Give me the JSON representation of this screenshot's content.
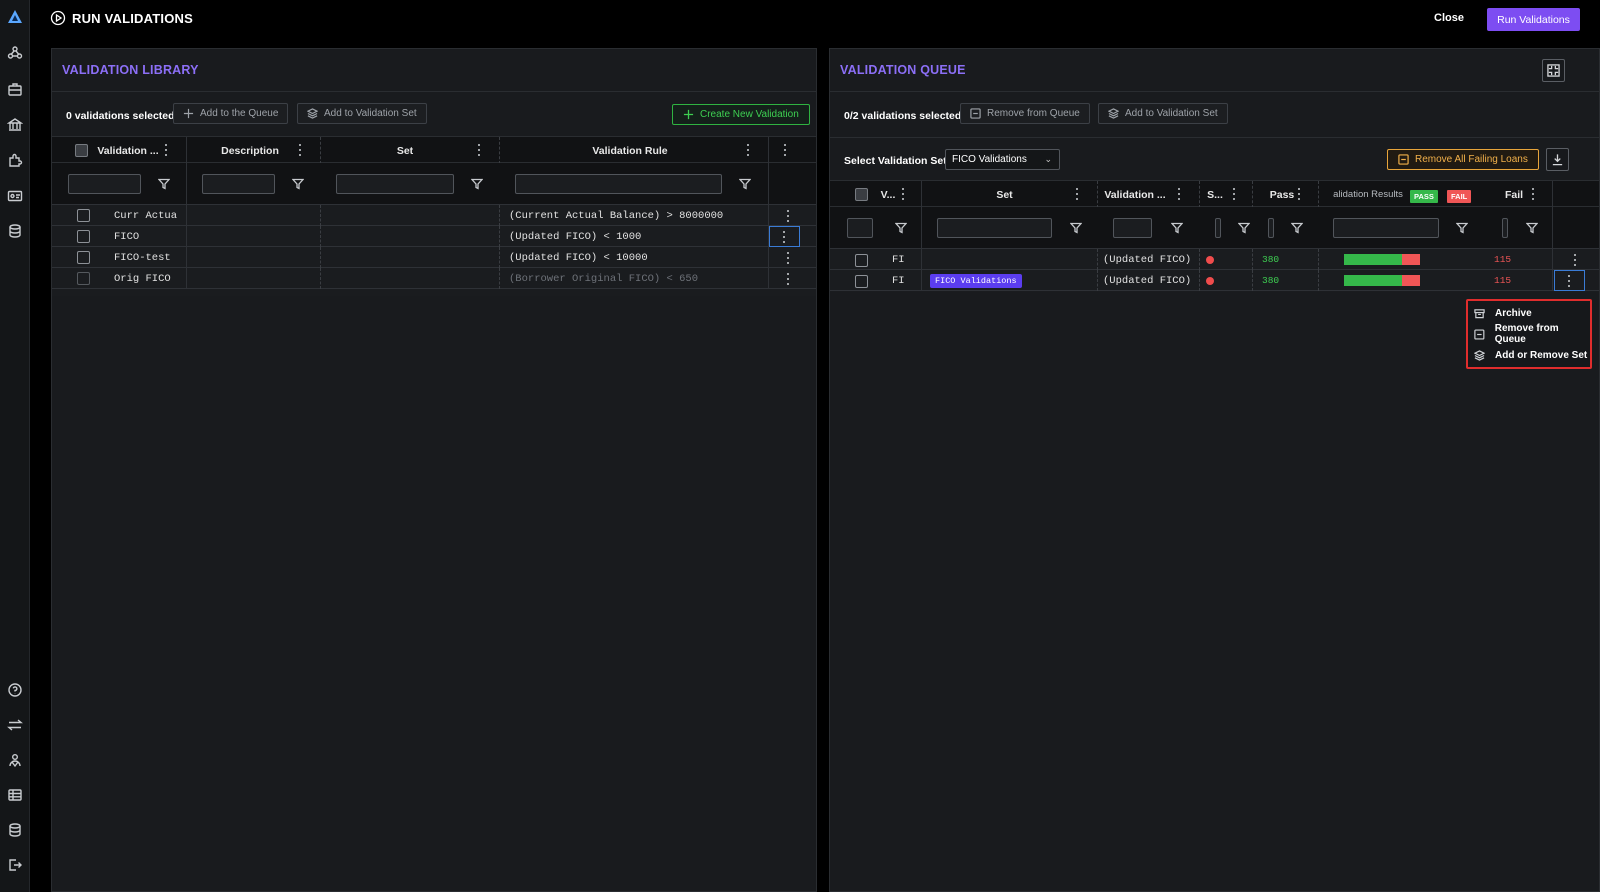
{
  "header": {
    "title": "RUN VALIDATIONS",
    "close_label": "Close",
    "run_label": "Run Validations"
  },
  "rail_icons": [
    "logo-icon",
    "network-icon",
    "briefcase-icon",
    "bank-icon",
    "puzzle-icon",
    "id-card-icon",
    "database-icon",
    "help-icon",
    "transfer-icon",
    "users-icon",
    "table-icon",
    "database-icon",
    "logout-icon"
  ],
  "library": {
    "title": "VALIDATION LIBRARY",
    "selected_text": "0 validations selected",
    "add_queue_label": "Add to the Queue",
    "add_set_label": "Add to Validation Set",
    "create_label": "Create New Validation",
    "columns": [
      "Validation ...",
      "Description",
      "Set",
      "Validation Rule"
    ],
    "rows": [
      {
        "name": "Curr Actua",
        "description": "",
        "set": "",
        "rule": "(Current Actual Balance) > 8000000",
        "disabled": false
      },
      {
        "name": "FICO",
        "description": "",
        "set": "",
        "rule": "(Updated FICO) < 1000",
        "disabled": false
      },
      {
        "name": "FICO-test",
        "description": "",
        "set": "",
        "rule": "(Updated FICO) < 10000",
        "disabled": false
      },
      {
        "name": "Orig FICO",
        "description": "",
        "set": "",
        "rule": "(Borrower Original FICO) < 650",
        "disabled": true
      }
    ]
  },
  "queue": {
    "title": "VALIDATION QUEUE",
    "selected_text": "0/2 validations selected",
    "remove_label": "Remove from Queue",
    "add_set_label": "Add to Validation Set",
    "select_set_label": "Select Validation Set",
    "select_set_value": "FICO Validations",
    "remove_failing_label": "Remove All Failing Loans",
    "columns": [
      "V...",
      "Set",
      "Validation ...",
      "S...",
      "Pass",
      "alidation Results",
      "Fail"
    ],
    "pass_pill": "PASS",
    "fail_pill": "FAIL",
    "rows": [
      {
        "v": "FI",
        "set": "",
        "validation": "(Updated FICO) >",
        "status": "fail",
        "pass": "380",
        "pass_fraction": 0.76,
        "fail": "115"
      },
      {
        "v": "FI",
        "set": "FICO Validations",
        "validation": "(Updated FICO) >",
        "status": "fail",
        "pass": "380",
        "pass_fraction": 0.76,
        "fail": "115"
      }
    ]
  },
  "context_menu": {
    "items": [
      "Archive",
      "Remove from Queue",
      "Add or Remove Set"
    ]
  },
  "colors": {
    "accent": "#7d4df2",
    "title": "#8c6ff7",
    "pass": "#35b84a",
    "fail": "#f05656",
    "create": "#2fb341",
    "warn": "#e8a53b"
  }
}
